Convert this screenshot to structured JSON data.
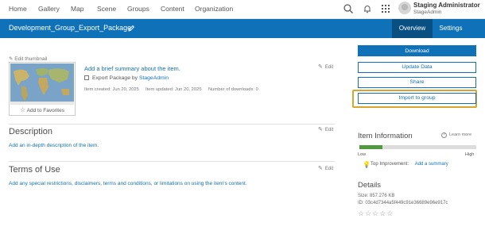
{
  "nav": {
    "items": [
      {
        "label": "Home"
      },
      {
        "label": "Gallery"
      },
      {
        "label": "Map"
      },
      {
        "label": "Scene"
      },
      {
        "label": "Groups"
      },
      {
        "label": "Content"
      },
      {
        "label": "Organization"
      }
    ],
    "user_name": "Staging Administrator",
    "user_sub": "StageAdmin"
  },
  "header": {
    "title": "Development_Group_Export_Package",
    "tabs": [
      {
        "label": "Overview",
        "active": true
      },
      {
        "label": "Settings",
        "active": false
      }
    ]
  },
  "item": {
    "edit_thumbnail": "Edit thumbnail",
    "add_to_favorites": "Add to Favorites",
    "summary_link": "Add a brief summary about the item.",
    "type_label": "Export Package by",
    "owner": "StageAdmin",
    "created": "Item created: Jun 20, 2025",
    "updated": "Item updated: Jun 20, 2025",
    "downloads": "Number of downloads: 0",
    "edit_label": "Edit"
  },
  "description": {
    "title": "Description",
    "link": "Add an in-depth description of the item."
  },
  "terms": {
    "title": "Terms of Use",
    "link": "Add any special restrictions, disclaimers, terms and conditions, or limitations on using the item's content."
  },
  "actions": {
    "download": "Download",
    "update_data": "Update Data",
    "share": "Share",
    "import_to_group": "Import to group"
  },
  "item_information": {
    "title": "Item Information",
    "learn_more": "Learn more",
    "progress": 0.2,
    "low": "Low",
    "high": "High",
    "top_improvement": "Top Improvement:",
    "add_summary": "Add a summary"
  },
  "details": {
    "title": "Details",
    "size": "Size: 857.276 KB",
    "id": "ID: 03c4d7344a5f449c91e36689e96e917c",
    "rating": 0
  },
  "colors": {
    "brand_blue": "#0f72b8",
    "header_active_tab": "#0a4f82",
    "highlight": "#d4a72c",
    "progress_green": "#4e9a3c"
  }
}
